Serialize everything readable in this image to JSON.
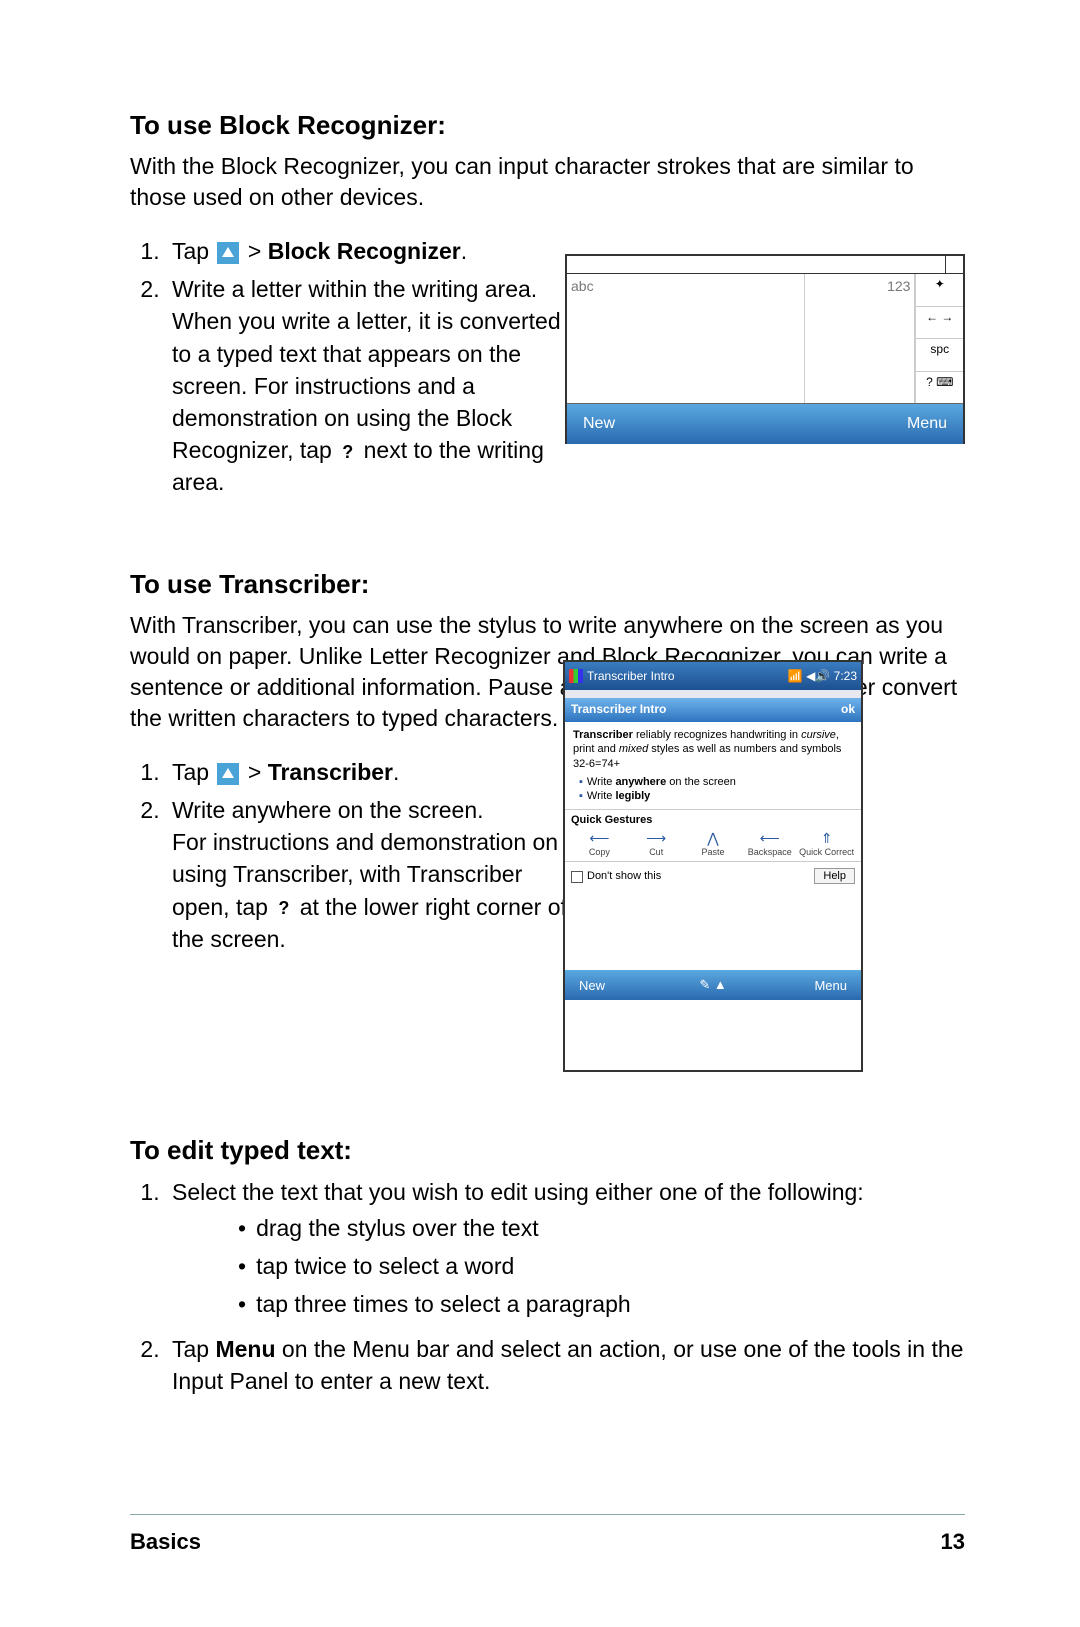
{
  "section1": {
    "heading": "To use Block Recognizer:",
    "intro": "With the Block Recognizer, you can input character strokes that are similar to those used on other devices.",
    "step1_prefix": "Tap ",
    "step1_mid": " > ",
    "step1_bold": "Block Recognizer",
    "step1_suffix": ".",
    "step2_line1": "Write a letter within the writing area.",
    "step2_para_a": "When you write a letter, it is converted to a typed text that appears on the screen. For instructions and a demonstration on using the Block Recognizer, tap ",
    "step2_para_b": " next to the writing area."
  },
  "fig_block": {
    "abc": "abc",
    "num": "123",
    "side": [
      "✦",
      "← →",
      "spc",
      "? ⌨"
    ],
    "menu_new": "New",
    "menu_menu": "Menu"
  },
  "section2": {
    "heading": "To use Transcriber:",
    "intro": "With Transcriber, you can use the stylus to write anywhere on the screen as you would on paper. Unlike Letter Recognizer and Block Recognizer, you can write a sentence or additional information. Pause after writing and let Transcriber convert the written characters to typed characters.",
    "step1_prefix": "Tap ",
    "step1_mid": " > ",
    "step1_bold": "Transcriber",
    "step1_suffix": ".",
    "step2_line1": "Write anywhere on the screen.",
    "step2_para_a": "For instructions and demonstration on using Transcriber, with Transcriber open, tap ",
    "step2_para_b": " at the lower right corner of the screen."
  },
  "fig_trans": {
    "titlebar_text": "Transcriber Intro",
    "titlebar_time": "7:23",
    "header_text": "Transcriber Intro",
    "header_ok": "ok",
    "desc_bold": "Transcriber",
    "desc_rest1": " reliably recognizes handwriting in ",
    "desc_cursive": "cursive",
    "desc_rest2": ", print and ",
    "desc_mixed": "mixed",
    "desc_rest3": " styles as well as numbers and symbols 32-6=74+",
    "tip1_a": "Write ",
    "tip1_b": "anywhere",
    "tip1_c": " on the screen",
    "tip2_a": "Write ",
    "tip2_b": "legibly",
    "gest_title": "Quick Gestures",
    "gest_items": [
      "Copy",
      "Cut",
      "Paste",
      "Backspace",
      "Quick Correct"
    ],
    "gest_syms": [
      "⟵",
      "⟶",
      "⋀",
      "⟵",
      "⇑"
    ],
    "dont_show": "Don't show this",
    "help": "Help",
    "bot_new": "New",
    "bot_mid": "✎ ▲",
    "bot_menu": "Menu"
  },
  "section3": {
    "heading": "To edit typed text:",
    "step1": "Select the text that you wish to edit using either one of the following:",
    "bullets": [
      "drag the stylus over the text",
      "tap twice to select a word",
      "tap three times to select a paragraph"
    ],
    "step2_a": "Tap ",
    "step2_bold": "Menu",
    "step2_b": " on the Menu bar and select an action, or use one of the tools in the Input Panel to enter a new text."
  },
  "footer": {
    "left": "Basics",
    "right": "13"
  },
  "q_mark": "?"
}
